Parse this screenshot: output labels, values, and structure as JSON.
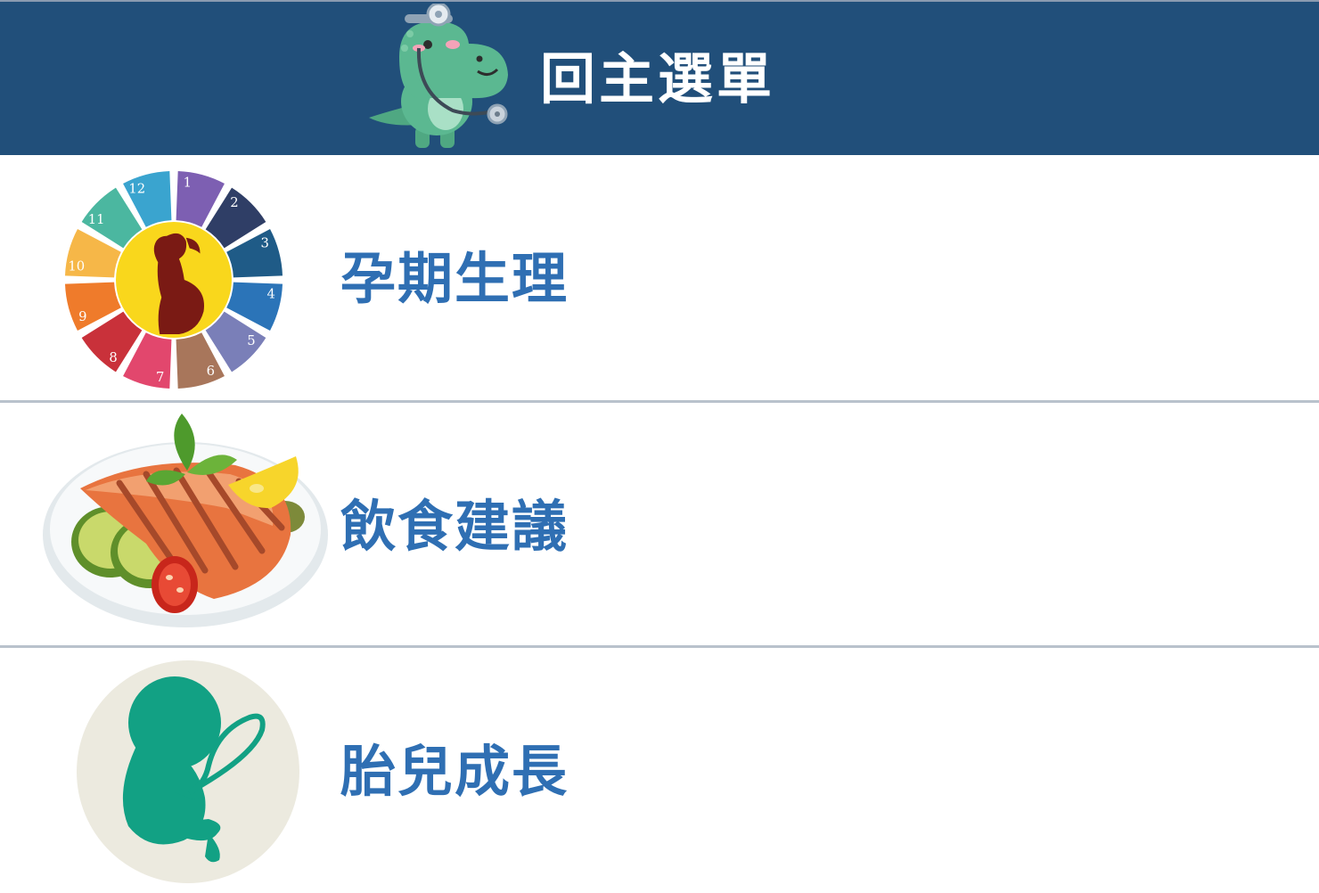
{
  "header": {
    "title": "回主選單",
    "icon": "dinosaur-doctor-icon",
    "background": "#214f7a"
  },
  "menu": {
    "items": [
      {
        "label": "孕期生理",
        "icon": "pregnancy-month-wheel-icon"
      },
      {
        "label": "飲食建議",
        "icon": "grilled-salmon-plate-icon"
      },
      {
        "label": "胎兒成長",
        "icon": "fetus-icon"
      }
    ],
    "label_color": "#2f6fb3"
  },
  "wheel": {
    "months": [
      "1",
      "2",
      "3",
      "4",
      "5",
      "6",
      "7",
      "8",
      "9",
      "10",
      "11",
      "12"
    ]
  }
}
